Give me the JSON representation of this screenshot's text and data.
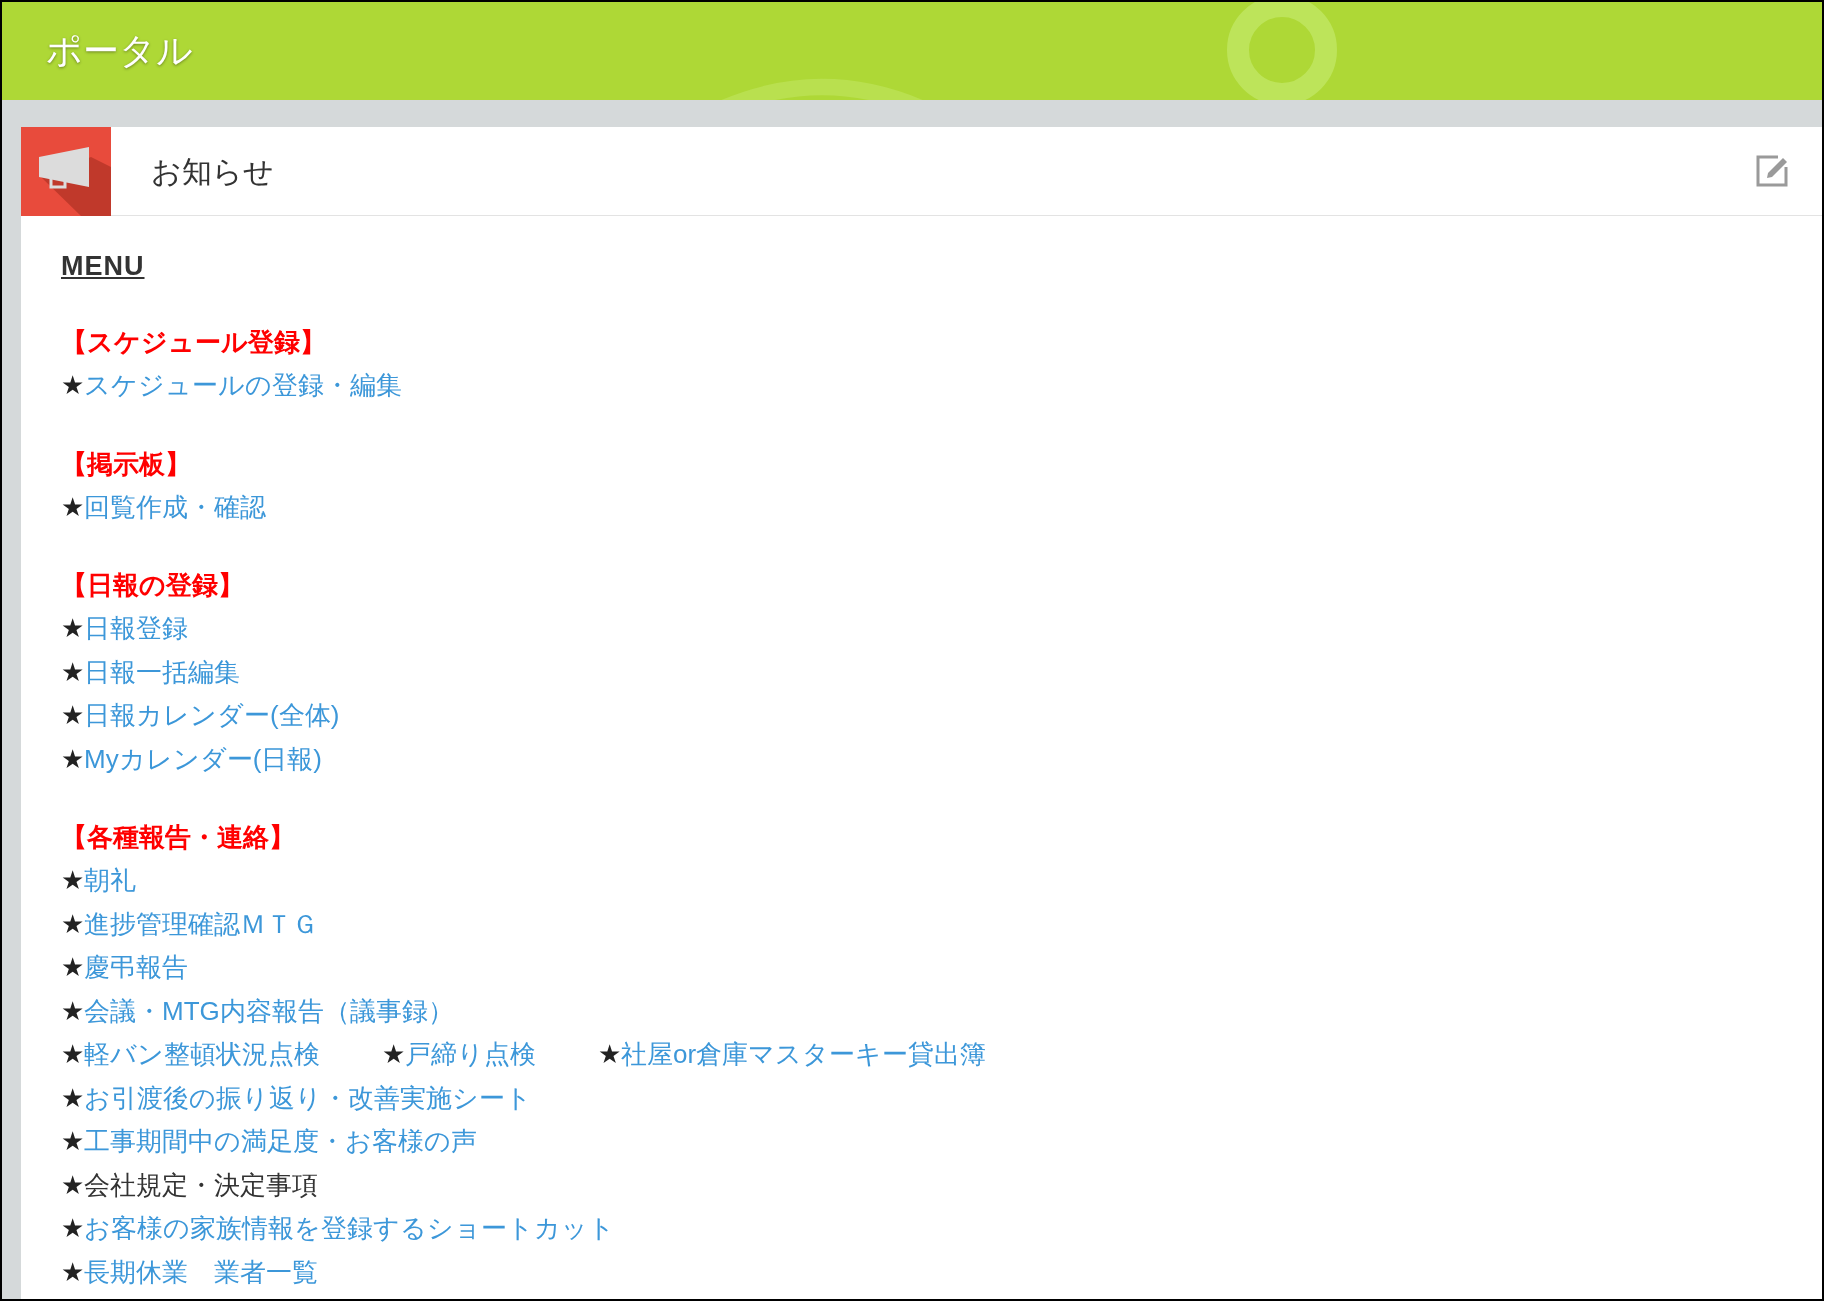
{
  "header": {
    "title": "ポータル"
  },
  "panel": {
    "title": "お知らせ"
  },
  "menu": {
    "title": "MENU",
    "sections": [
      {
        "heading": "【スケジュール登録】",
        "lines": [
          [
            {
              "marker": "★",
              "label": "スケジュールの登録・編集",
              "kind": "link"
            }
          ]
        ]
      },
      {
        "heading": "【掲示板】",
        "lines": [
          [
            {
              "marker": "★",
              "label": "回覧作成・確認",
              "kind": "link"
            }
          ]
        ]
      },
      {
        "heading": "【日報の登録】",
        "lines": [
          [
            {
              "marker": "★",
              "label": "日報登録",
              "kind": "link"
            }
          ],
          [
            {
              "marker": "★",
              "label": "日報一括編集",
              "kind": "link"
            }
          ],
          [
            {
              "marker": "★",
              "label": "日報カレンダー(全体)",
              "kind": "link"
            }
          ],
          [
            {
              "marker": "★",
              "label": "Myカレンダー(日報)",
              "kind": "link"
            }
          ]
        ]
      },
      {
        "heading": "【各種報告・連絡】",
        "lines": [
          [
            {
              "marker": "★",
              "label": "朝礼",
              "kind": "link"
            }
          ],
          [
            {
              "marker": "★",
              "label": "進捗管理確認ＭＴＧ",
              "kind": "link"
            }
          ],
          [
            {
              "marker": "★",
              "label": "慶弔報告",
              "kind": "link"
            }
          ],
          [
            {
              "marker": "★",
              "label": "会議・MTG内容報告（議事録）",
              "kind": "link"
            }
          ],
          [
            {
              "marker": "★",
              "label": "軽バン整頓状況点検",
              "kind": "link"
            },
            {
              "marker": "★",
              "label": "戸締り点検",
              "kind": "link"
            },
            {
              "marker": "★",
              "label": "社屋or倉庫マスターキー貸出簿",
              "kind": "link"
            }
          ],
          [
            {
              "marker": "★",
              "label": "お引渡後の振り返り・改善実施シート",
              "kind": "link"
            }
          ],
          [
            {
              "marker": "★",
              "label": "工事期間中の満足度・お客様の声",
              "kind": "link"
            }
          ],
          [
            {
              "marker": "★",
              "label": "会社規定・決定事項",
              "kind": "text"
            }
          ],
          [
            {
              "marker": "★",
              "label": "お客様の家族情報を登録するショートカット",
              "kind": "link"
            }
          ],
          [
            {
              "marker": "★",
              "label": "長期休業　業者一覧",
              "kind": "link"
            }
          ]
        ]
      }
    ]
  }
}
